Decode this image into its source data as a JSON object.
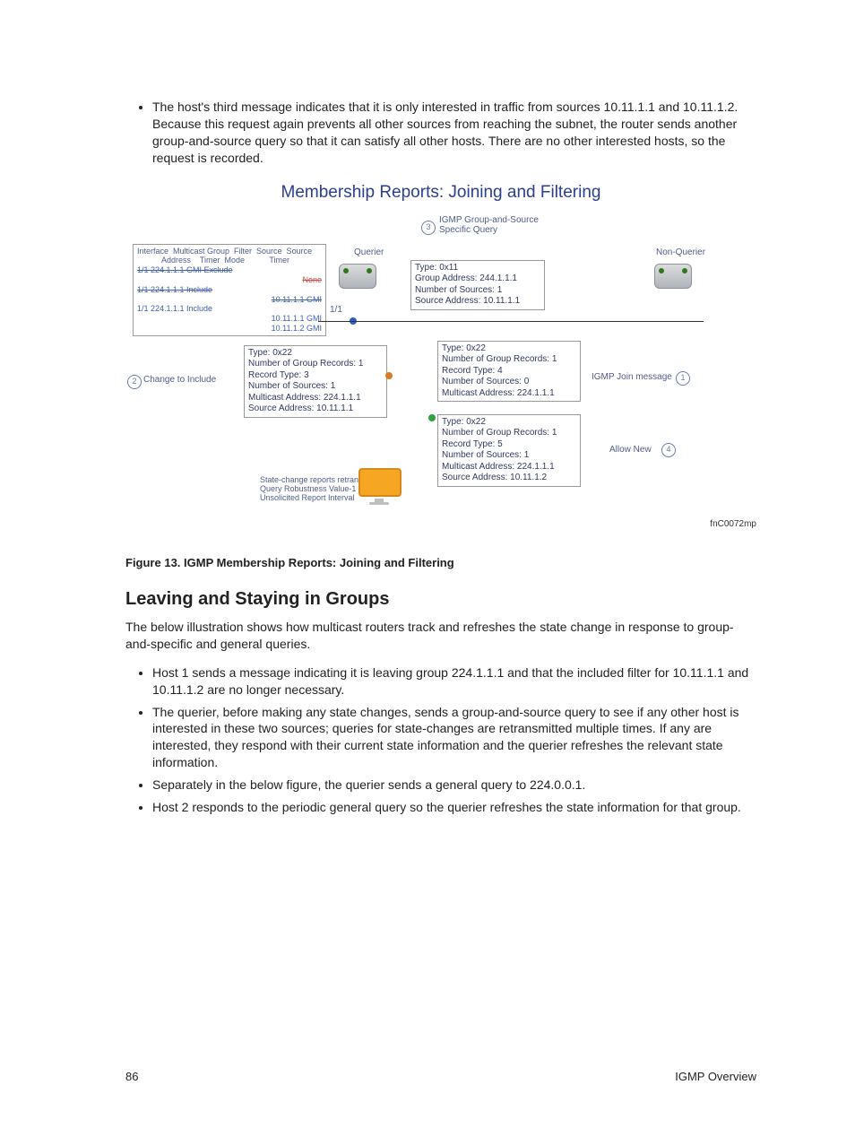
{
  "top_bullet": "The host's third message indicates that it is only interested in traffic from sources 10.11.1.1 and 10.11.1.2. Because this request again prevents all other sources from reaching the subnet, the router sends another group-and-source query so that it can satisfy all other hosts. There are no other interested hosts, so the request is recorded.",
  "figure": {
    "title": "Membership Reports: Joining and Filtering",
    "querier_label": "Querier",
    "non_querier_label": "Non-Querier",
    "step3_label": "IGMP Group-and-Source Specific Query",
    "step1_label": "IGMP Join message",
    "step4_label": "Allow New",
    "change_to_include": "Change to Include",
    "port_label": "1/1",
    "table_header": "Interface  Multicast Group  Filter  Source  Source\n           Address    Timer  Mode           Timer",
    "row1": "1/1   224.1.1.1  GMI  Exclude",
    "row1_none": "None",
    "row2": "1/1   224.1.1.1        Include",
    "row2_src": "10.11.1.1  GMI",
    "row3": "1/1   224.1.1.1        Include",
    "row3_src1": "10.11.1.1  GMI",
    "row3_src2": "10.11.1.2  GMI",
    "query_box": {
      "l1": "Type: 0x11",
      "l2": "Group Address: 244.1.1.1",
      "l3": "Number of Sources: 1",
      "l4": "Source Address: 10.11.1.1"
    },
    "box_change": {
      "l1": "Type: 0x22",
      "l2": "Number of Group Records: 1",
      "l3": "Record Type: 3",
      "l4": "Number of Sources: 1",
      "l5": "Multicast Address: 224.1.1.1",
      "l6": "Source Address: 10.11.1.1"
    },
    "box_join": {
      "l1": "Type: 0x22",
      "l2": "Number of Group Records: 1",
      "l3": "Record Type: 4",
      "l4": "Number of Sources: 0",
      "l5": "Multicast Address: 224.1.1.1"
    },
    "box_allow": {
      "l1": "Type: 0x22",
      "l2": "Number of Group Records: 1",
      "l3": "Record Type: 5",
      "l4": "Number of Sources: 1",
      "l5": "Multicast Address: 224.1.1.1",
      "l6": "Source Address: 10.11.1.2"
    },
    "retransmit_note": "State-change reports retransmitted Query Robustness Value-1 times at Unsolicited Report Interval",
    "fig_id": "fnC0072mp"
  },
  "caption": "Figure 13. IGMP Membership Reports: Joining and Filtering",
  "section_heading": "Leaving and Staying in Groups",
  "section_intro": "The below illustration shows how multicast routers track and refreshes the state change in response to group-and-specific and general queries.",
  "bullets2": [
    "Host 1 sends a message indicating it is leaving group 224.1.1.1 and that the included filter for 10.11.1.1 and 10.11.1.2 are no longer necessary.",
    "The querier, before making any state changes, sends a group-and-source query to see if any other host is interested in these two sources; queries for state-changes are retransmitted multiple times. If any are interested, they respond with their current state information and the querier refreshes the relevant state information.",
    "Separately in the below figure, the querier sends a general query to 224.0.0.1.",
    "Host 2 responds to the periodic general query so the querier refreshes the state information for that group."
  ],
  "page_number": "86",
  "footer_right": "IGMP Overview"
}
